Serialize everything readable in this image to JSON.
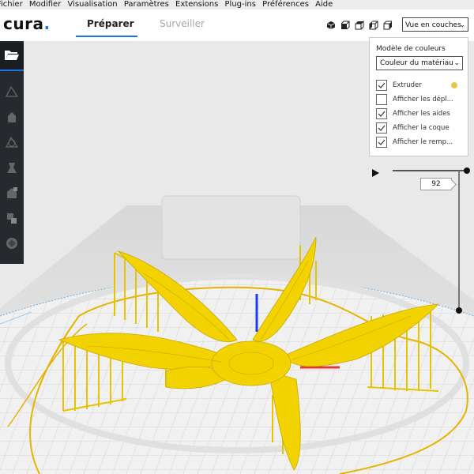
{
  "menu": [
    "Fichier",
    "Modifier",
    "Visualisation",
    "Paramètres",
    "Extensions",
    "Plug-ins",
    "Préférences",
    "Aide"
  ],
  "logo": {
    "text": "cura",
    "dot": "."
  },
  "tabs": {
    "prepare": "Préparer",
    "monitor": "Surveiller"
  },
  "view_select": {
    "value": "Vue en couches"
  },
  "color_panel": {
    "title": "Modèle de couleurs",
    "scheme": "Couleur du matériau",
    "items": [
      {
        "label": "Extruder",
        "checked": true
      },
      {
        "label": "Afficher les dépl...",
        "checked": false
      },
      {
        "label": "Afficher les aides",
        "checked": true
      },
      {
        "label": "Afficher la coque",
        "checked": true
      },
      {
        "label": "Afficher le remp...",
        "checked": true
      }
    ],
    "extruder_color": "#e8c44a"
  },
  "layer": {
    "current": "92"
  },
  "colors": {
    "accent": "#1a73e8",
    "model": "#f2d300",
    "sidebar": "#262a2e"
  },
  "icons": {
    "sidebar": [
      "folder-open-icon",
      "translate-tool-icon",
      "scale-tool-icon",
      "rotate-tool-icon",
      "mirror-tool-icon",
      "per-model-settings-icon",
      "support-blocker-icon",
      "layer-3d-icon"
    ],
    "views": [
      "3d-view-icon",
      "front-view-icon",
      "top-view-icon",
      "left-view-icon",
      "right-view-icon"
    ],
    "play": "play-icon"
  }
}
